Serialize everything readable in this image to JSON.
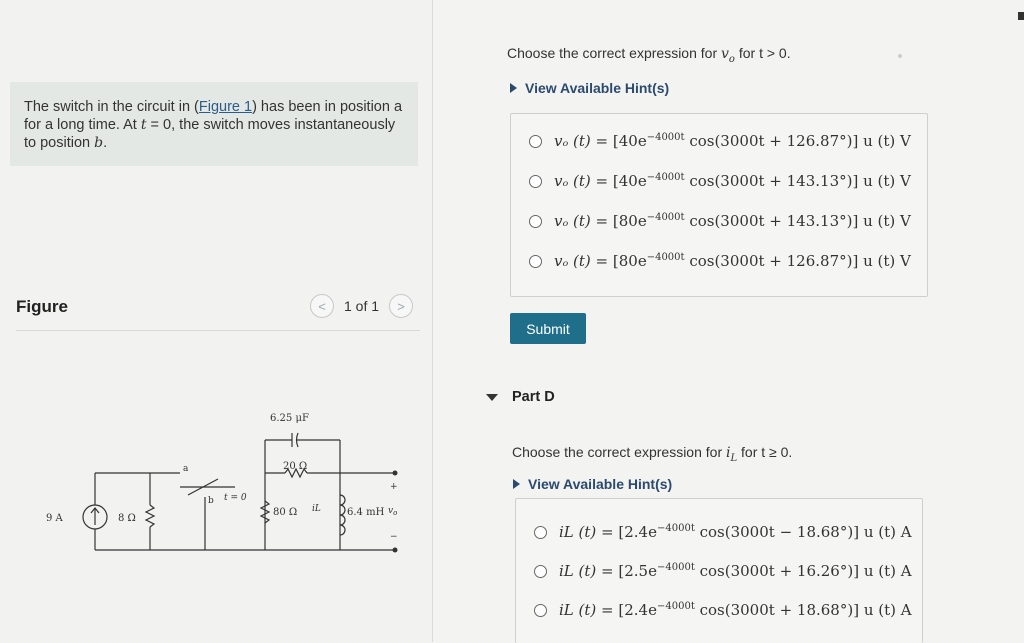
{
  "problem": {
    "text_before": "The switch in the circuit in (",
    "link": "Figure 1",
    "text_mid": ") has been in position a for a long time. At ",
    "t_var": "t",
    "eq_zero": " = 0, the switch moves instantaneously to position ",
    "position_b": "b",
    "text_end": "."
  },
  "figure": {
    "title": "Figure",
    "pager_prev": "<",
    "pager_text": "1 of 1",
    "pager_next": ">",
    "labels": {
      "cap": "6.25 μF",
      "r20": "20 Ω",
      "source": "9 A",
      "r8": "8 Ω",
      "r80": "80 Ω",
      "iL": "iL",
      "ind": "6.4 mH",
      "vo": "v",
      "vo_sub": "o",
      "a": "a",
      "b": "b",
      "t0": "t = 0",
      "plus": "+",
      "minus": "−"
    }
  },
  "partC": {
    "question_prefix": "Choose the correct expression for ",
    "question_var": "v",
    "question_var_sub": "o",
    "question_suffix": " for t > 0.",
    "hint_label": "View Available Hint(s)",
    "options": [
      {
        "coef": "40",
        "phase": "126.87°"
      },
      {
        "coef": "40",
        "phase": "143.13°"
      },
      {
        "coef": "80",
        "phase": "143.13°"
      },
      {
        "coef": "80",
        "phase": "126.87°"
      }
    ],
    "submit_label": "Submit"
  },
  "partD": {
    "heading": "Part D",
    "question_prefix": "Choose the correct expression for ",
    "question_var": "i",
    "question_var_sub": "L",
    "question_suffix": " for t ≥ 0.",
    "hint_label": "View Available Hint(s)",
    "options": [
      {
        "coef": "2.4",
        "phase": "3000t − 18.68°"
      },
      {
        "coef": "2.5",
        "phase": "3000t + 16.26°"
      },
      {
        "coef": "2.4",
        "phase": "3000t + 18.68°"
      }
    ]
  },
  "expr": {
    "vo_lhs": "vₒ (t) = ",
    "iL_lhs": "iL (t) = ",
    "exp_sup": "−4000t",
    "cos_pre": " cos(3000t + ",
    "cos_pre_plain": " cos(",
    "tail_v": ")] u (t) V",
    "tail_a": ")] u (t) A"
  }
}
